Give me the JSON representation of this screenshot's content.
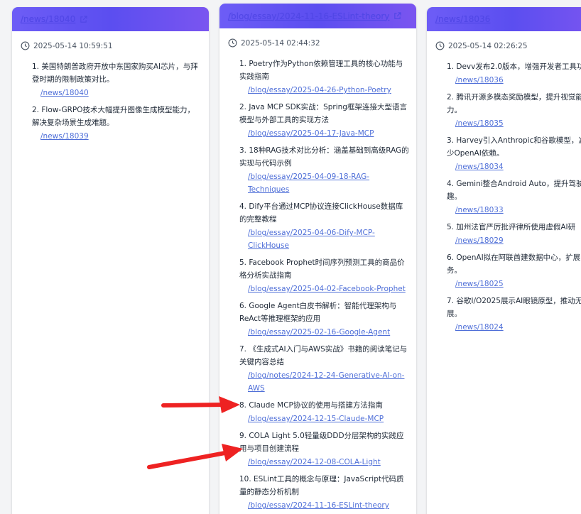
{
  "cards": [
    {
      "header_link": "/news/18040",
      "timestamp": "2025-05-14 10:59:51",
      "items": [
        {
          "title": "1. 美国特朗普政府开放中东国家购买AI芯片，与拜登时期的限制政策对比。",
          "link": "/news/18040"
        },
        {
          "title": "2. Flow-GRPO技术大幅提升图像生成模型能力，解决复杂场景生成难题。",
          "link": "/news/18039"
        }
      ]
    },
    {
      "header_link": "/blog/essay/2024-11-16-ESLint-theory",
      "timestamp": "2025-05-14 02:44:32",
      "items": [
        {
          "title": "1. Poetry作为Python依赖管理工具的核心功能与实践指南",
          "link": "/blog/essay/2025-04-26-Python-Poetry"
        },
        {
          "title": "2. Java MCP SDK实战：Spring框架连接大型语言模型与外部工具的实现方法",
          "link": "/blog/essay/2025-04-17-Java-MCP"
        },
        {
          "title": "3. 18种RAG技术对比分析：涵盖基础到高级RAG的实现与代码示例",
          "link": "/blog/essay/2025-04-09-18-RAG-Techniques"
        },
        {
          "title": "4. Dify平台通过MCP协议连接ClickHouse数据库的完整教程",
          "link": "/blog/essay/2025-04-06-Dify-MCP-ClickHouse"
        },
        {
          "title": "5. Facebook Prophet时间序列预测工具的商品价格分析实战指南",
          "link": "/blog/essay/2025-04-02-Facebook-Prophet"
        },
        {
          "title": "6. Google Agent白皮书解析：智能代理架构与ReAct等推理框架的应用",
          "link": "/blog/essay/2025-02-16-Google-Agent"
        },
        {
          "title": "7. 《生成式AI入门与AWS实战》书籍的阅读笔记与关键内容总结",
          "link": "/blog/notes/2024-12-24-Generative-AI-on-AWS"
        },
        {
          "title": "8. Claude MCP协议的使用与搭建方法指南",
          "link": "/blog/essay/2024-12-15-Claude-MCP"
        },
        {
          "title": "9. COLA Light 5.0轻量级DDD分层架构的实践应用与项目创建流程",
          "link": "/blog/essay/2024-12-08-COLA-Light"
        },
        {
          "title": "10. ESLint工具的概念与原理：JavaScript代码质量的静态分析机制",
          "link": "/blog/essay/2024-11-16-ESLint-theory"
        }
      ]
    },
    {
      "header_link": "/news/18036",
      "timestamp": "2025-05-14 02:26:25",
      "items": [
        {
          "title": "1. Devv发布2.0版本，增强开发者工具功",
          "link": "/news/18036"
        },
        {
          "title": "2. 腾讯开源多模态奖励模型，提升视觉能力。",
          "link": "/news/18035"
        },
        {
          "title": "3. Harvey引入Anthropic和谷歌模型，减少OpenAI依赖。",
          "link": "/news/18034"
        },
        {
          "title": "4. Gemini整合Android Auto，提升驾驶趣。",
          "link": "/news/18033"
        },
        {
          "title": "5. 加州法官严厉批评律所使用虚假AI研",
          "link": "/news/18029"
        },
        {
          "title": "6. OpenAI拟在阿联酋建数据中心，扩展务。",
          "link": "/news/18025"
        },
        {
          "title": "7. 谷歌I/O2025展示AI眼镜原型，推动无发展。",
          "link": "/news/18024"
        }
      ]
    }
  ],
  "colors": {
    "header_gradient": "#6d5df6",
    "link": "#4f6fd8",
    "arrow": "#ee2222"
  },
  "icons": [
    "external-link-icon",
    "clock-icon",
    "arrow-annotation"
  ]
}
